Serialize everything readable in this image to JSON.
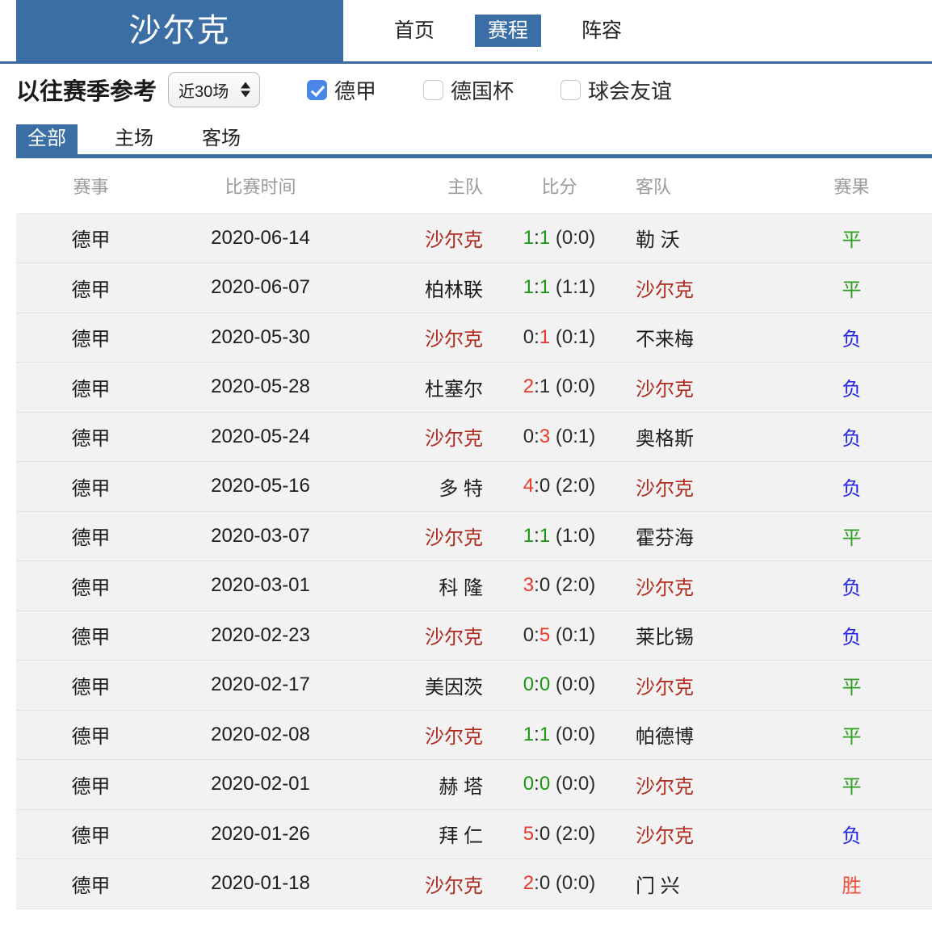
{
  "header": {
    "team_name": "沙尔克",
    "nav": [
      {
        "label": "首页",
        "active": false
      },
      {
        "label": "赛程",
        "active": true
      },
      {
        "label": "阵容",
        "active": false
      }
    ]
  },
  "filters": {
    "title": "以往赛季参考",
    "range_select": {
      "value": "近30场"
    },
    "competitions": [
      {
        "label": "德甲",
        "checked": true
      },
      {
        "label": "德国杯",
        "checked": false
      },
      {
        "label": "球会友谊",
        "checked": false
      }
    ]
  },
  "venue_tabs": [
    {
      "label": "全部",
      "active": true
    },
    {
      "label": "主场",
      "active": false
    },
    {
      "label": "客场",
      "active": false
    }
  ],
  "table": {
    "columns": [
      "赛事",
      "比赛时间",
      "主队",
      "比分",
      "客队",
      "赛果"
    ],
    "focus_team": "沙尔克",
    "rows": [
      {
        "league": "德甲",
        "date": "2020-06-14",
        "home": "沙尔克",
        "home_hl": true,
        "hs": "1",
        "as": "1",
        "ht": "(0:0)",
        "away": "勒 沃",
        "away_hl": false,
        "result": "平",
        "result_type": "draw"
      },
      {
        "league": "德甲",
        "date": "2020-06-07",
        "home": "柏林联",
        "home_hl": false,
        "hs": "1",
        "as": "1",
        "ht": "(1:1)",
        "away": "沙尔克",
        "away_hl": true,
        "result": "平",
        "result_type": "draw"
      },
      {
        "league": "德甲",
        "date": "2020-05-30",
        "home": "沙尔克",
        "home_hl": true,
        "hs": "0",
        "as": "1",
        "ht": "(0:1)",
        "away": "不来梅",
        "away_hl": false,
        "result": "负",
        "result_type": "lose"
      },
      {
        "league": "德甲",
        "date": "2020-05-28",
        "home": "杜塞尔",
        "home_hl": false,
        "hs": "2",
        "as": "1",
        "ht": "(0:0)",
        "away": "沙尔克",
        "away_hl": true,
        "result": "负",
        "result_type": "lose"
      },
      {
        "league": "德甲",
        "date": "2020-05-24",
        "home": "沙尔克",
        "home_hl": true,
        "hs": "0",
        "as": "3",
        "ht": "(0:1)",
        "away": "奥格斯",
        "away_hl": false,
        "result": "负",
        "result_type": "lose"
      },
      {
        "league": "德甲",
        "date": "2020-05-16",
        "home": "多 特",
        "home_hl": false,
        "hs": "4",
        "as": "0",
        "ht": "(2:0)",
        "away": "沙尔克",
        "away_hl": true,
        "result": "负",
        "result_type": "lose"
      },
      {
        "league": "德甲",
        "date": "2020-03-07",
        "home": "沙尔克",
        "home_hl": true,
        "hs": "1",
        "as": "1",
        "ht": "(1:0)",
        "away": "霍芬海",
        "away_hl": false,
        "result": "平",
        "result_type": "draw"
      },
      {
        "league": "德甲",
        "date": "2020-03-01",
        "home": "科 隆",
        "home_hl": false,
        "hs": "3",
        "as": "0",
        "ht": "(2:0)",
        "away": "沙尔克",
        "away_hl": true,
        "result": "负",
        "result_type": "lose"
      },
      {
        "league": "德甲",
        "date": "2020-02-23",
        "home": "沙尔克",
        "home_hl": true,
        "hs": "0",
        "as": "5",
        "ht": "(0:1)",
        "away": "莱比锡",
        "away_hl": false,
        "result": "负",
        "result_type": "lose"
      },
      {
        "league": "德甲",
        "date": "2020-02-17",
        "home": "美因茨",
        "home_hl": false,
        "hs": "0",
        "as": "0",
        "ht": "(0:0)",
        "away": "沙尔克",
        "away_hl": true,
        "result": "平",
        "result_type": "draw"
      },
      {
        "league": "德甲",
        "date": "2020-02-08",
        "home": "沙尔克",
        "home_hl": true,
        "hs": "1",
        "as": "1",
        "ht": "(0:0)",
        "away": "帕德博",
        "away_hl": false,
        "result": "平",
        "result_type": "draw"
      },
      {
        "league": "德甲",
        "date": "2020-02-01",
        "home": "赫 塔",
        "home_hl": false,
        "hs": "0",
        "as": "0",
        "ht": "(0:0)",
        "away": "沙尔克",
        "away_hl": true,
        "result": "平",
        "result_type": "draw"
      },
      {
        "league": "德甲",
        "date": "2020-01-26",
        "home": "拜 仁",
        "home_hl": false,
        "hs": "5",
        "as": "0",
        "ht": "(2:0)",
        "away": "沙尔克",
        "away_hl": true,
        "result": "负",
        "result_type": "lose"
      },
      {
        "league": "德甲",
        "date": "2020-01-18",
        "home": "沙尔克",
        "home_hl": true,
        "hs": "2",
        "as": "0",
        "ht": "(0:0)",
        "away": "门 兴",
        "away_hl": false,
        "result": "胜",
        "result_type": "win"
      }
    ]
  },
  "colors": {
    "brand_blue": "#3a6ea5",
    "highlight_team": "#b02a1d",
    "score_win": "#e8392c",
    "score_draw": "#1b9612",
    "result_win": "#f4503c",
    "result_draw": "#2e9b23",
    "result_lose": "#2424e6",
    "checkbox_on": "#4a86e8"
  }
}
